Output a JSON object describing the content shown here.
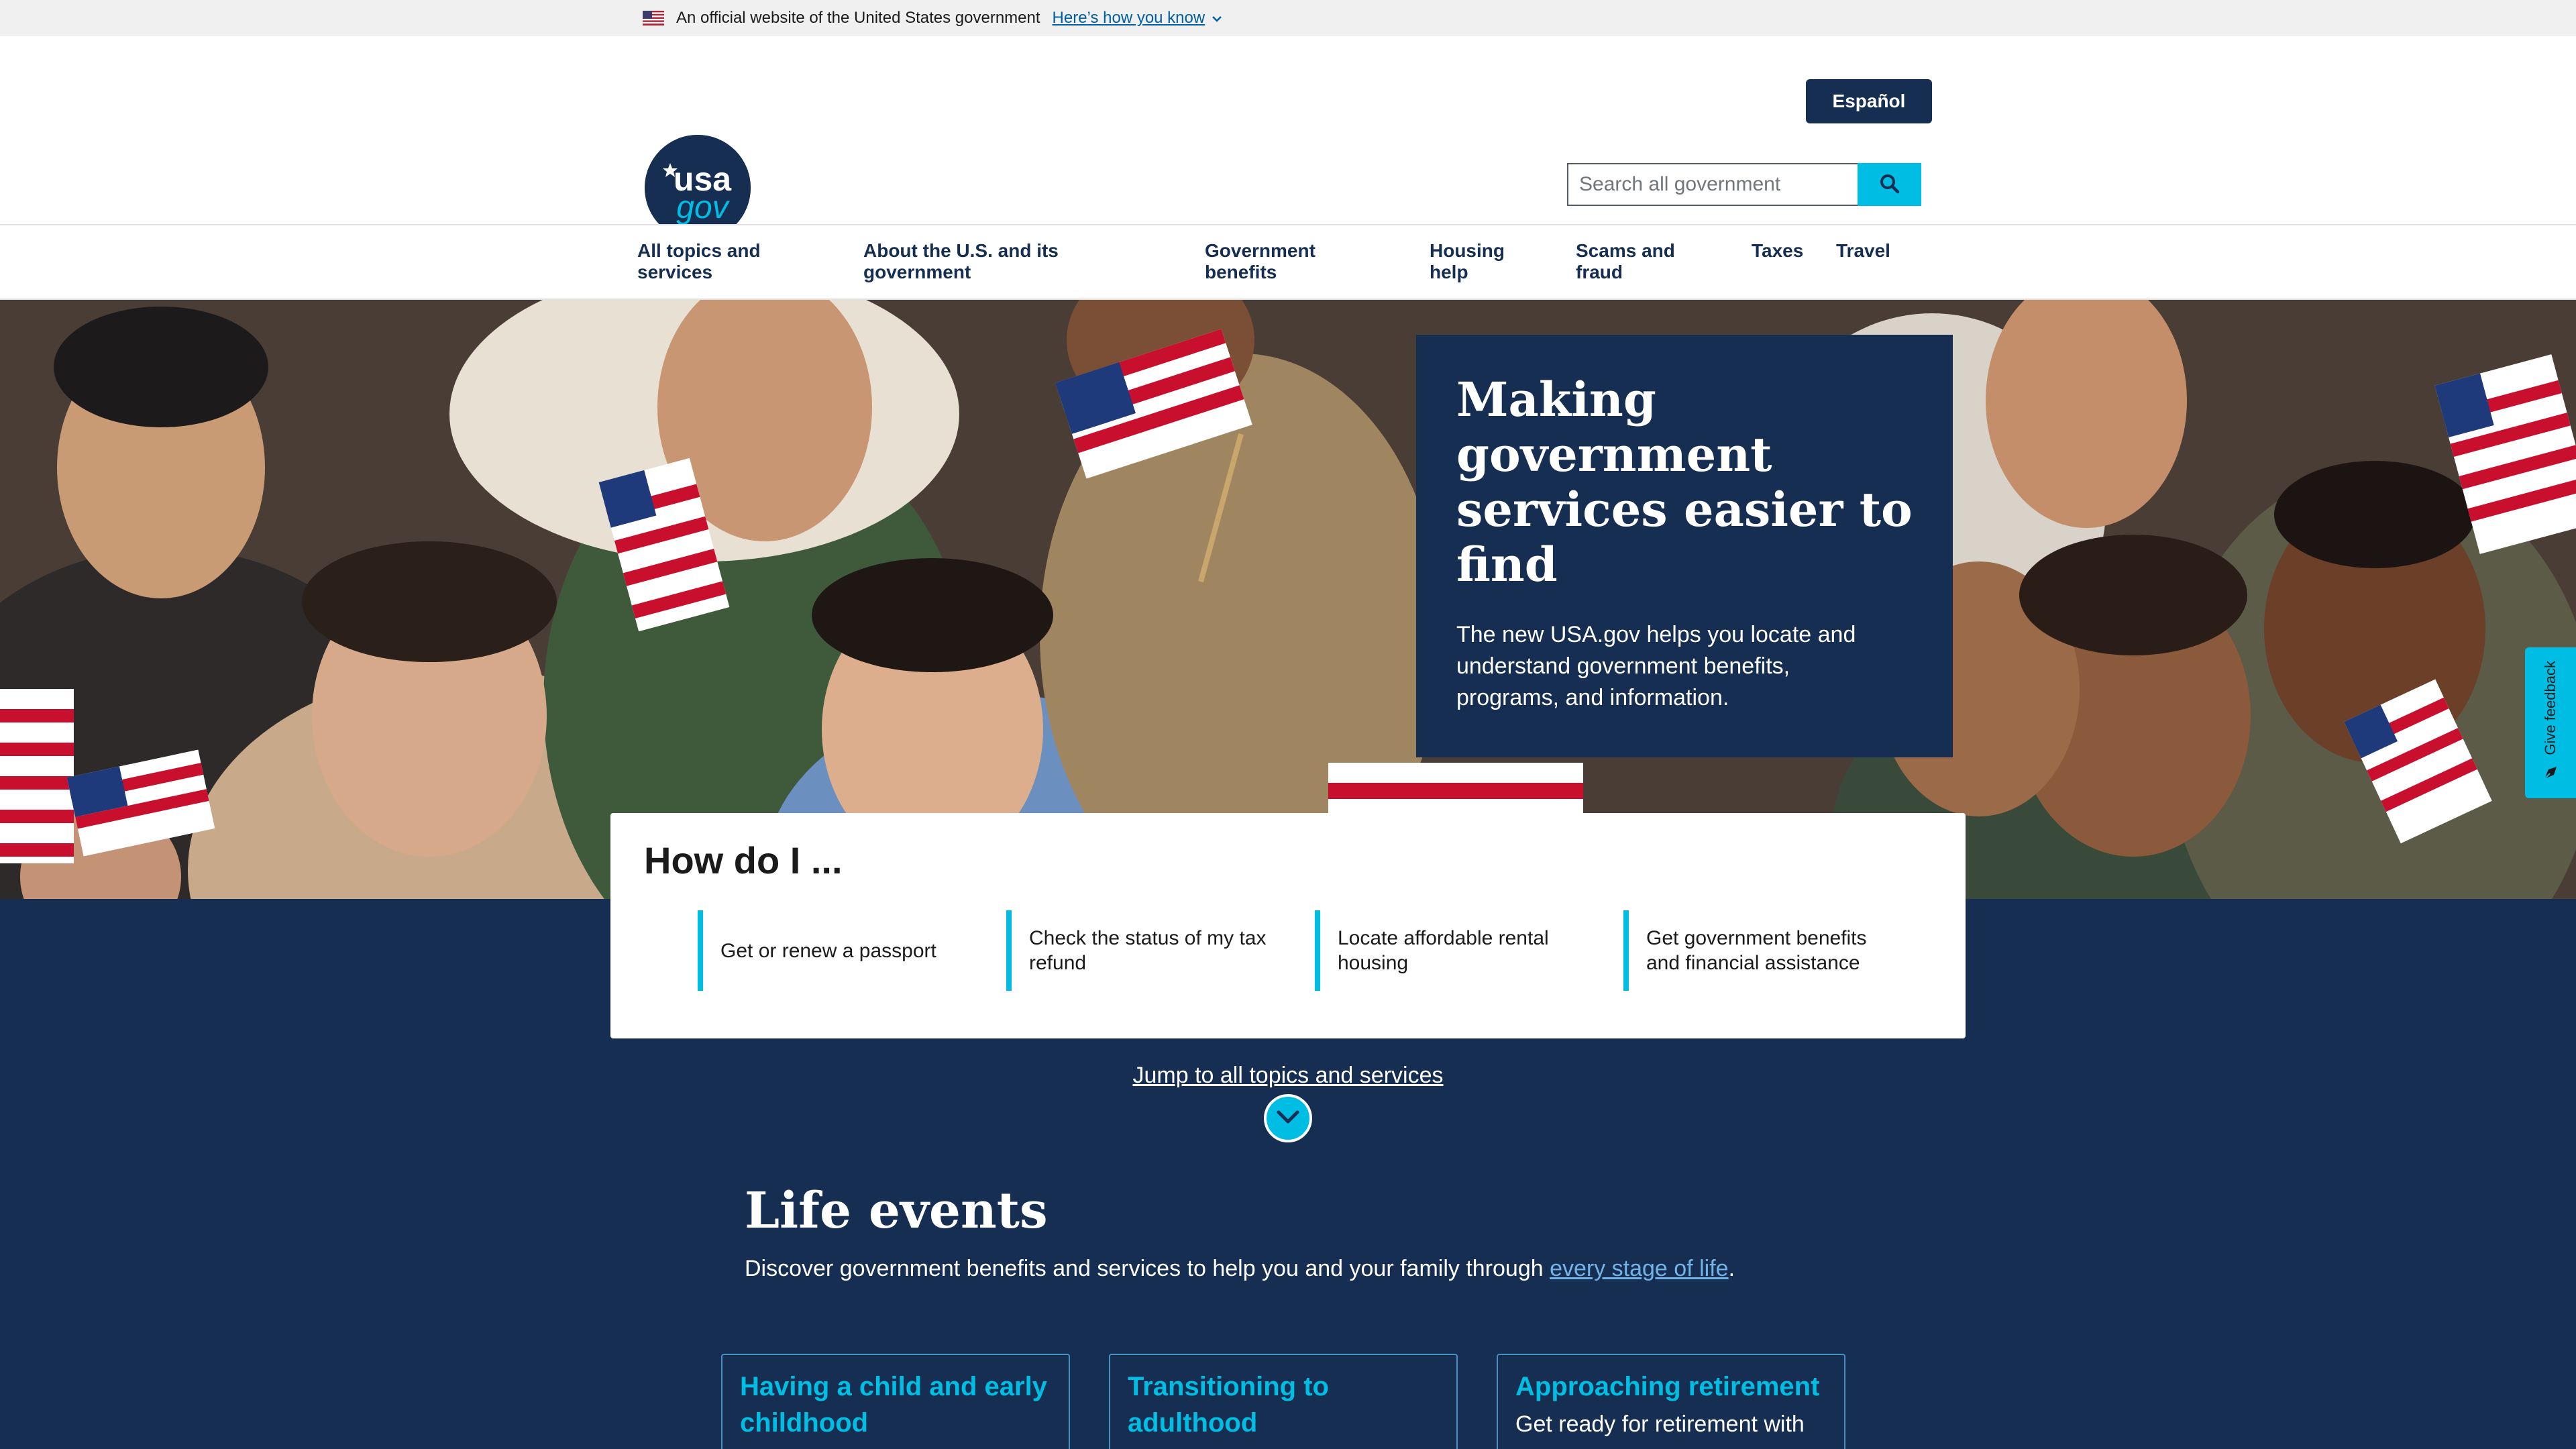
{
  "banner": {
    "official_text": "An official website of the United States government",
    "how_you_know": "Here’s how you know"
  },
  "header": {
    "language_button": "Español",
    "logo_text_top": "usa",
    "logo_text_bottom": "gov",
    "search_placeholder": "Search all government"
  },
  "nav": {
    "items": [
      {
        "line1": "All topics and",
        "line2": "services"
      },
      {
        "line1": "About the U.S. and its",
        "line2": "government"
      },
      {
        "line1": "Government",
        "line2": "benefits"
      },
      {
        "line1": "Housing",
        "line2": "help"
      },
      {
        "line1": "Scams and",
        "line2": "fraud"
      },
      {
        "line1": "Taxes",
        "line2": ""
      },
      {
        "line1": "Travel",
        "line2": ""
      }
    ]
  },
  "hero": {
    "title_lines": [
      "Making",
      "government",
      "services easier to",
      "find"
    ],
    "subtitle_lines": [
      "The new USA.gov helps you locate and",
      "understand government benefits,",
      "programs, and information."
    ]
  },
  "how_do_i": {
    "title": "How do I ...",
    "items": [
      {
        "line1": "Get or renew a passport",
        "line2": ""
      },
      {
        "line1": "Check the status of my tax",
        "line2": "refund"
      },
      {
        "line1": "Locate affordable rental",
        "line2": "housing"
      },
      {
        "line1": "Get government benefits",
        "line2": "and financial assistance"
      }
    ]
  },
  "jump_link": "Jump to all topics and services",
  "life_events": {
    "title": "Life events",
    "description_before": "Discover government benefits and services to help you and your family through ",
    "description_link": "every stage of life",
    "description_after": ".",
    "cards": [
      {
        "title_line1": "Having a child and early",
        "title_line2": "childhood",
        "text": ""
      },
      {
        "title_line1": "Transitioning to",
        "title_line2": "adulthood",
        "text": ""
      },
      {
        "title_line1": "Approaching retirement",
        "title_line2": "",
        "text": "Get ready for retirement with"
      }
    ]
  },
  "feedback": {
    "label": "Give feedback"
  },
  "colors": {
    "navy": "#162e51",
    "cyan": "#00bde3",
    "banner_gray": "#f0f0f0",
    "link_blue": "#005ea2"
  },
  "icons": [
    "us-flag-icon",
    "chevron-down-icon",
    "search-icon",
    "chevron-down-circle-icon",
    "feedback-icon"
  ]
}
